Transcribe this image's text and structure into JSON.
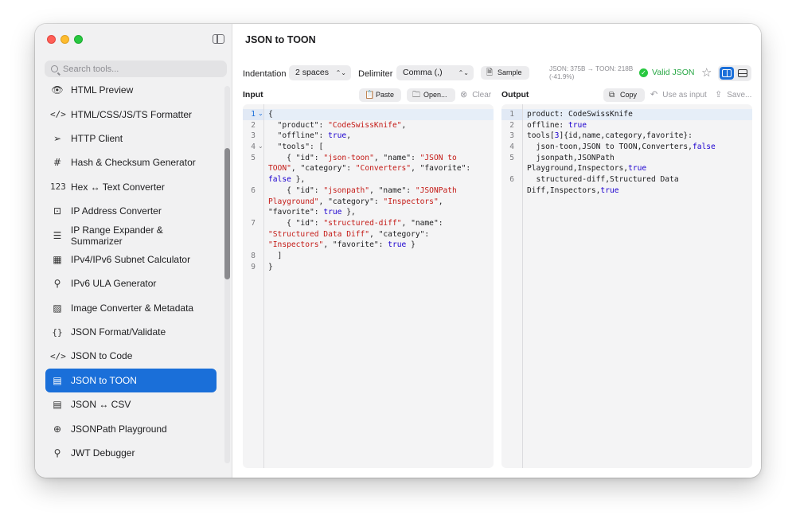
{
  "window": {
    "title": "JSON to TOON"
  },
  "sidebar": {
    "search_placeholder": "Search tools...",
    "items": [
      {
        "label": "HTML Preview",
        "icon": "eye-icon",
        "glyph": "👁",
        "active": false
      },
      {
        "label": "HTML/CSS/JS/TS Formatter",
        "icon": "code-icon",
        "glyph": "</>",
        "active": false
      },
      {
        "label": "HTTP Client",
        "icon": "paper-plane-icon",
        "glyph": "➢",
        "active": false
      },
      {
        "label": "Hash & Checksum Generator",
        "icon": "hash-icon",
        "glyph": "#",
        "active": false
      },
      {
        "label": "Hex ↔ Text Converter",
        "icon": "numbers-icon",
        "glyph": "123",
        "active": false
      },
      {
        "label": "IP Address Converter",
        "icon": "ip-icon",
        "glyph": "⊡",
        "active": false
      },
      {
        "label": "IP Range Expander & Summarizer",
        "icon": "list-icon",
        "glyph": "☰",
        "active": false
      },
      {
        "label": "IPv4/IPv6 Subnet Calculator",
        "icon": "grid-icon",
        "glyph": "▦",
        "active": false
      },
      {
        "label": "IPv6 ULA Generator",
        "icon": "key-icon",
        "glyph": "⚲",
        "active": false
      },
      {
        "label": "Image Converter & Metadata",
        "icon": "photo-icon",
        "glyph": "▨",
        "active": false
      },
      {
        "label": "JSON Format/Validate",
        "icon": "braces-icon",
        "glyph": "{}",
        "active": false
      },
      {
        "label": "JSON to Code",
        "icon": "code-icon",
        "glyph": "</>",
        "active": false
      },
      {
        "label": "JSON to TOON",
        "icon": "table-icon",
        "glyph": "▤",
        "active": true
      },
      {
        "label": "JSON ↔ CSV",
        "icon": "table-icon",
        "glyph": "▤",
        "active": false
      },
      {
        "label": "JSONPath Playground",
        "icon": "magnifier-icon",
        "glyph": "⊕",
        "active": false
      },
      {
        "label": "JWT Debugger",
        "icon": "key-icon",
        "glyph": "⚲",
        "active": false
      }
    ]
  },
  "toolbar": {
    "indentation_label": "Indentation",
    "indentation_value": "2 spaces",
    "delimiter_label": "Delimiter",
    "delimiter_value": "Comma (,)",
    "sample_label": "Sample",
    "stats_line1": "JSON: 375B → TOON: 218B",
    "stats_line2": "(-41.9%)",
    "valid_label": "Valid JSON",
    "accent_color": "#1a6fd9",
    "valid_color": "#28a745"
  },
  "input_pane": {
    "title": "Input",
    "paste_label": "Paste",
    "open_label": "Open...",
    "clear_label": "Clear",
    "lines": [
      "1",
      "2",
      "3",
      "4",
      "5",
      "6",
      "7",
      "8",
      "9"
    ]
  },
  "output_pane": {
    "title": "Output",
    "copy_label": "Copy",
    "use_as_input_label": "Use as input",
    "save_label": "Save...",
    "lines": [
      "1",
      "2",
      "3",
      "4",
      "5",
      "6"
    ]
  }
}
